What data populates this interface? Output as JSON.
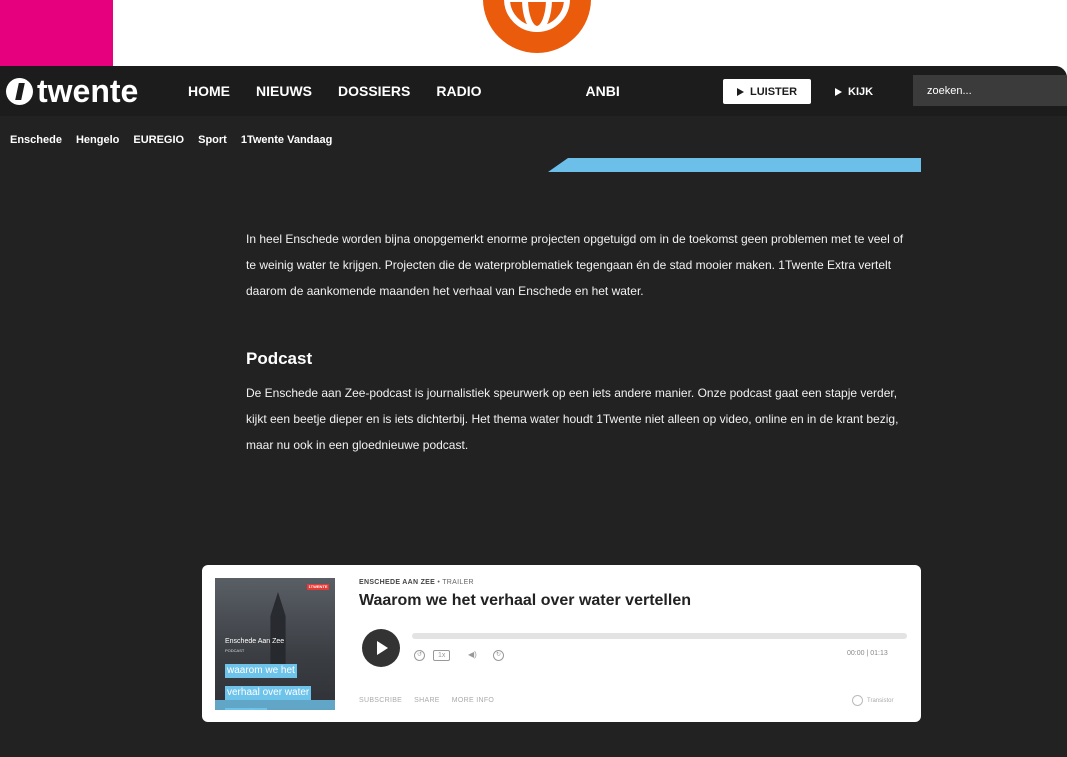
{
  "nav": {
    "logo": "twente",
    "menu": [
      "HOME",
      "NIEUWS",
      "DOSSIERS",
      "RADIO",
      "ANBI"
    ],
    "listen_label": "LUISTER",
    "watch_label": "KIJK",
    "search_placeholder": "zoeken..."
  },
  "subnav": [
    "Enschede",
    "Hengelo",
    "EUREGIO",
    "Sport",
    "1Twente Vandaag"
  ],
  "article": {
    "lead": "In heel Enschede worden bijna onopgemerkt enorme projecten opgetuigd om in de toekomst geen problemen met te veel of te weinig water te krijgen. Projecten die de waterproblematiek tegengaan én de stad mooier maken. 1Twente Extra vertelt daarom de aankomende maanden het verhaal van Enschede en het water.",
    "heading": "Podcast",
    "body": "De Enschede aan Zee-podcast is journalistiek speurwerk op een iets andere manier. Onze podcast gaat een stapje verder, kijkt een beetje dieper en is iets dichterbij. Het thema water houdt 1Twente niet alleen op video, online en in de krant bezig, maar nu ook in een gloednieuwe podcast."
  },
  "player": {
    "show": "ENSCHEDE AAN ZEE",
    "episode_type": "TRAILER",
    "title": "Waarom we het verhaal over water vertellen",
    "cover_show": "Enschede Aan Zee",
    "cover_sub": "PODCAST",
    "cover_lines": [
      "waarom we het",
      "verhaal over water",
      "vertellen"
    ],
    "cover_brand": "1TWENTE",
    "speed": "1x",
    "time": "00:00 | 01:13",
    "links": [
      "SUBSCRIBE",
      "SHARE",
      "MORE INFO"
    ],
    "brand": "Transistor",
    "progress": 0
  }
}
